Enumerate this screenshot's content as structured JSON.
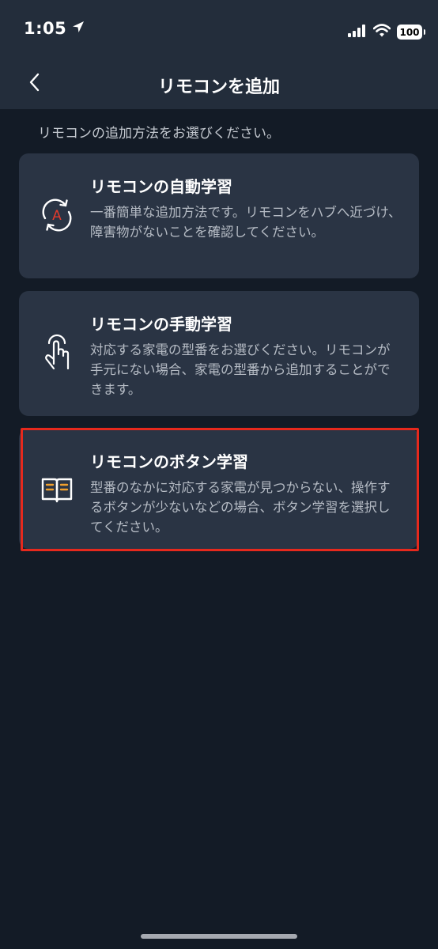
{
  "status_bar": {
    "time": "1:05",
    "battery": "100"
  },
  "nav": {
    "title": "リモコンを追加"
  },
  "instruction": "リモコンの追加方法をお選びください。",
  "options": [
    {
      "title": "リモコンの自動学習",
      "description": "一番簡単な追加方法です。リモコンをハブへ近づけ、障害物がないことを確認してください。",
      "icon": "auto-learn-icon"
    },
    {
      "title": "リモコンの手動学習",
      "description": "対応する家電の型番をお選びください。リモコンが手元にない場合、家電の型番から追加することができます。",
      "icon": "touch-hand-icon"
    },
    {
      "title": "リモコンのボタン学習",
      "description": "型番のなかに対応する家電が見つからない、操作するボタンが少ないなどの場合、ボタン学習を選択してください。",
      "icon": "open-book-icon"
    }
  ],
  "colors": {
    "background": "#131b26",
    "header": "#232d3b",
    "card": "#2a3444",
    "highlight": "#e6291d",
    "accent_red": "#e33a2c",
    "accent_orange": "#f0a02e"
  }
}
